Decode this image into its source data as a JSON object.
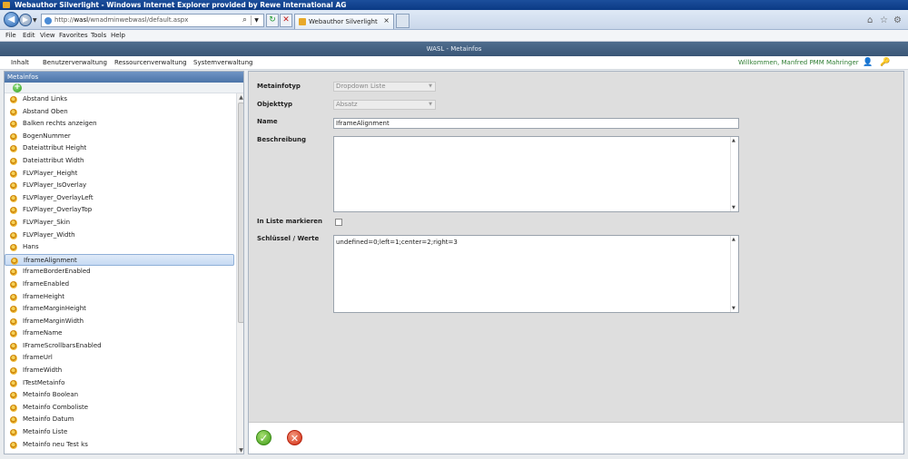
{
  "window": {
    "title": "Webauthor Silverlight - Windows Internet Explorer provided by Rewe International AG"
  },
  "browser": {
    "url_prefix": "http://",
    "url_host": "wasl",
    "url_path": "/wnadminwebwasl/default.aspx",
    "tab_title": "Webauthor Silverlight",
    "tab_close": "×"
  },
  "menu": {
    "file": "File",
    "edit": "Edit",
    "view": "View",
    "favorites": "Favorites",
    "tools": "Tools",
    "help": "Help"
  },
  "app": {
    "title": "WASL - Metainfos",
    "nav": [
      "Inhalt",
      "Benutzerverwaltung",
      "Ressourcenverwaltung",
      "Systemverwaltung"
    ],
    "welcome": "Willkommen, Manfred PMM Mahringer"
  },
  "left": {
    "header": "Metainfos",
    "items": [
      "Abstand Links",
      "Abstand Oben",
      "Balken rechts anzeigen",
      "BogenNummer",
      "Dateiattribut Height",
      "Dateiattribut Width",
      "FLVPlayer_Height",
      "FLVPlayer_IsOverlay",
      "FLVPlayer_OverlayLeft",
      "FLVPlayer_OverlayTop",
      "FLVPlayer_Skin",
      "FLVPlayer_Width",
      "Hans",
      "IframeAlignment",
      "IframeBorderEnabled",
      "IframeEnabled",
      "IframeHeight",
      "IframeMarginHeight",
      "IframeMarginWidth",
      "IframeName",
      "IFrameScrollbarsEnabled",
      "IframeUrl",
      "IframeWidth",
      "ITestMetainfo",
      "Metainfo Boolean",
      "Metainfo Comboliste",
      "Metainfo Datum",
      "Metainfo Liste",
      "Metainfo neu Test ks"
    ],
    "selected_index": 13
  },
  "form": {
    "metainfotyp_label": "Metainfotyp",
    "metainfotyp_value": "Dropdown Liste",
    "objekttyp_label": "Objekttyp",
    "objekttyp_value": "Absatz",
    "name_label": "Name",
    "name_value": "IframeAlignment",
    "beschreibung_label": "Beschreibung",
    "beschreibung_value": "",
    "inliste_label": "In Liste markieren",
    "inliste_checked": false,
    "schluessel_label": "Schlüssel / Werte",
    "schluessel_value": "undefined=0;left=1;center=2;right=3"
  },
  "colors": {
    "accent": "#4b74a8",
    "welcome": "#2e7d32",
    "ok": "#3f9a18",
    "cancel": "#d22a10"
  }
}
